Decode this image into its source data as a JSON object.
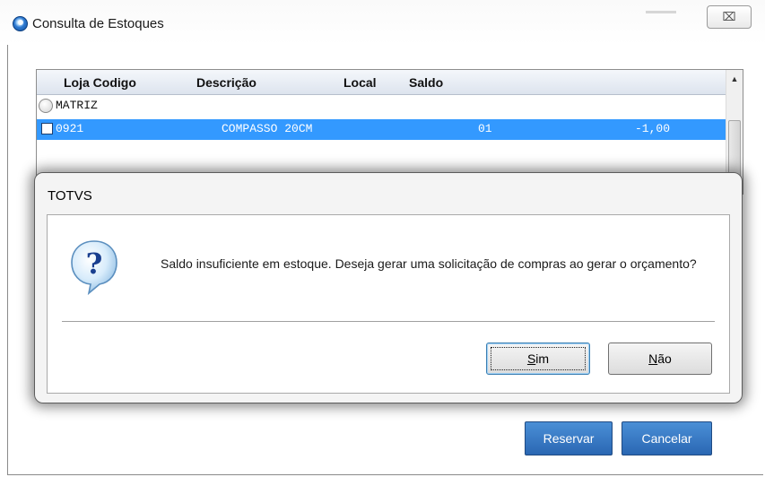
{
  "window": {
    "title": "Consulta de Estoques",
    "close_label": "⌧"
  },
  "grid": {
    "headers": [
      "Loja Codigo",
      "Descrição",
      "Local",
      "Saldo"
    ],
    "group_row": "MATRIZ",
    "item_row": {
      "code": "0921",
      "description": "COMPASSO 20CM",
      "local": "01",
      "saldo": "-1,00"
    },
    "scroll_up": "▲"
  },
  "actions": {
    "reservar_label": "Reservar",
    "cancelar_label": "Cancelar"
  },
  "dialog": {
    "title": "TOTVS",
    "message": "Saldo insuficiente em estoque. Deseja gerar uma solicitação de compras ao gerar o orçamento?",
    "sim_access": "S",
    "sim_rest": "im",
    "nao_access": "N",
    "nao_rest": "ão",
    "icon": "question-icon"
  },
  "colors": {
    "selection": "#3399ff",
    "button_blue": "#2a67b3"
  }
}
